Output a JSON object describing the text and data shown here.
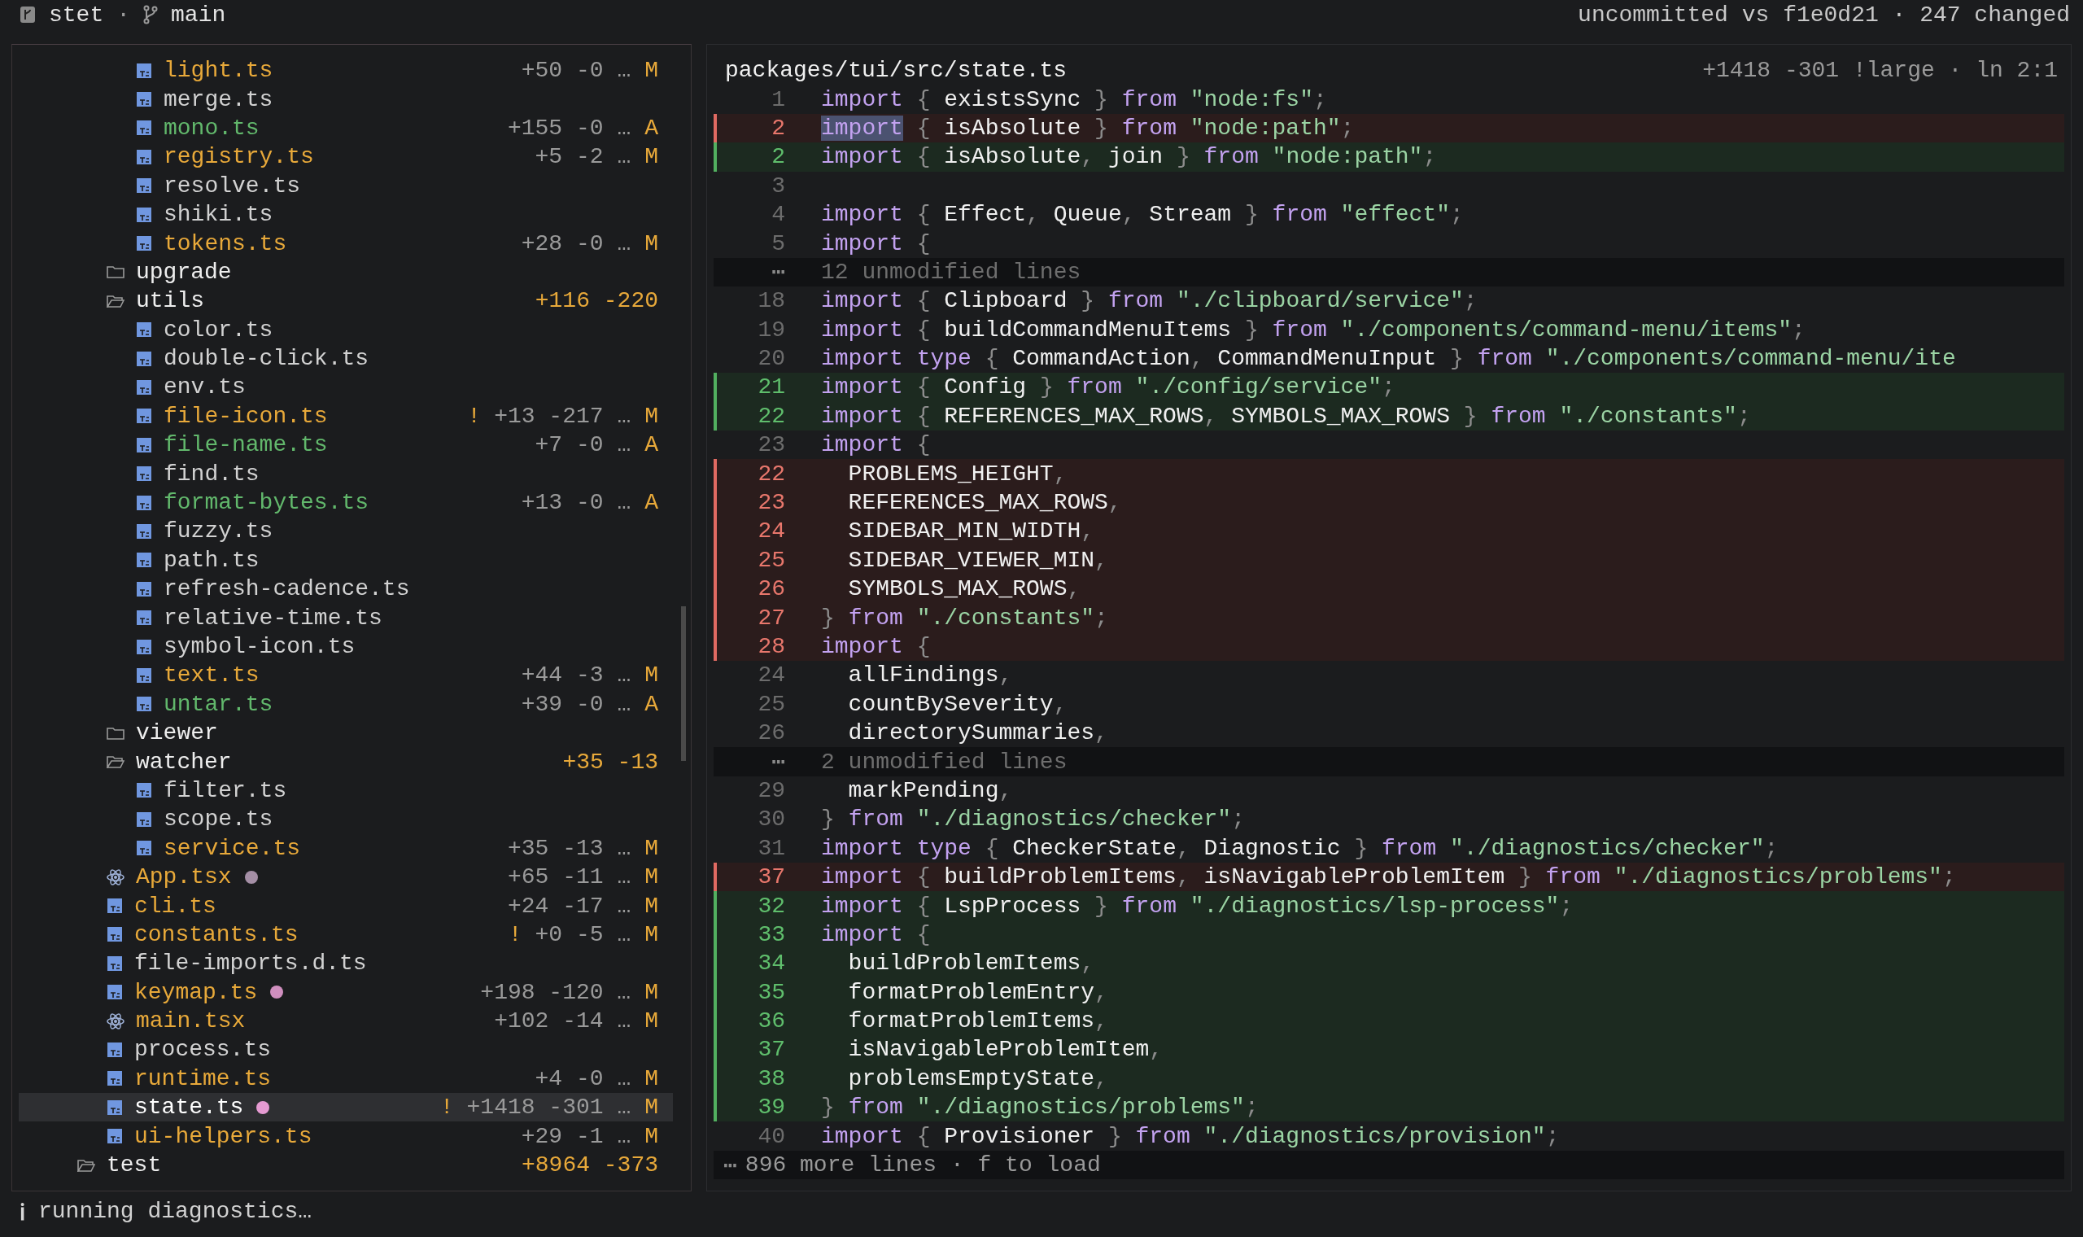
{
  "top_bar": {
    "repo": "stet",
    "separator": "·",
    "branch": "main",
    "summary": "uncommitted vs f1e0d21 · 247 changed"
  },
  "tree": [
    {
      "kind": "group",
      "children": [
        {
          "kind": "group",
          "children": [
            {
              "kind": "ts",
              "name": "light.ts",
              "stats": "+50 -0 …",
              "status": "M",
              "selected": false
            },
            {
              "kind": "ts",
              "name": "merge.ts",
              "selected": false
            },
            {
              "kind": "ts",
              "name": "mono.ts",
              "stats": "+155 -0 …",
              "status": "A",
              "selected": false
            },
            {
              "kind": "ts",
              "name": "registry.ts",
              "stats": "+5 -2 …",
              "status": "M",
              "selected": false
            },
            {
              "kind": "ts",
              "name": "resolve.ts",
              "selected": false
            },
            {
              "kind": "ts",
              "name": "shiki.ts",
              "selected": false
            },
            {
              "kind": "ts",
              "name": "tokens.ts",
              "stats": "+28 -0 …",
              "status": "M",
              "selected": false
            }
          ]
        },
        {
          "kind": "folder",
          "name": "upgrade",
          "expanded": false,
          "selected": false
        },
        {
          "kind": "folder",
          "name": "utils",
          "expanded": true,
          "stats": "+116 -220",
          "selected": false,
          "children": [
            {
              "kind": "ts",
              "name": "color.ts",
              "selected": false
            },
            {
              "kind": "ts",
              "name": "double-click.ts",
              "selected": false
            },
            {
              "kind": "ts",
              "name": "env.ts",
              "selected": false
            },
            {
              "kind": "ts",
              "name": "file-icon.ts",
              "warning": "!",
              "stats": "+13 -217 …",
              "status": "M",
              "selected": false
            },
            {
              "kind": "ts",
              "name": "file-name.ts",
              "stats": "+7 -0 …",
              "status": "A",
              "selected": false
            },
            {
              "kind": "ts",
              "name": "find.ts",
              "selected": false
            },
            {
              "kind": "ts",
              "name": "format-bytes.ts",
              "stats": "+13 -0 …",
              "status": "A",
              "selected": false
            },
            {
              "kind": "ts",
              "name": "fuzzy.ts",
              "selected": false
            },
            {
              "kind": "ts",
              "name": "path.ts",
              "selected": false
            },
            {
              "kind": "ts",
              "name": "refresh-cadence.ts",
              "selected": false
            },
            {
              "kind": "ts",
              "name": "relative-time.ts",
              "selected": false
            },
            {
              "kind": "ts",
              "name": "symbol-icon.ts",
              "selected": false
            },
            {
              "kind": "ts",
              "name": "text.ts",
              "stats": "+44 -3 …",
              "status": "M",
              "selected": false
            },
            {
              "kind": "ts",
              "name": "untar.ts",
              "stats": "+39 -0 …",
              "status": "A",
              "selected": false
            }
          ]
        },
        {
          "kind": "folder",
          "name": "viewer",
          "expanded": false,
          "selected": false
        },
        {
          "kind": "folder",
          "name": "watcher",
          "expanded": true,
          "stats": "+35 -13",
          "selected": false,
          "children": [
            {
              "kind": "ts",
              "name": "filter.ts",
              "selected": false
            },
            {
              "kind": "ts",
              "name": "scope.ts",
              "selected": false
            },
            {
              "kind": "ts",
              "name": "service.ts",
              "stats": "+35 -13 …",
              "status": "M",
              "selected": false
            }
          ]
        },
        {
          "kind": "tsx",
          "name": "App.tsx",
          "color": "#a58fa6",
          "stats": "+65 -11 …",
          "status": "M",
          "selected": false
        },
        {
          "kind": "ts",
          "name": "cli.ts",
          "stats": "+24 -17 …",
          "status": "M",
          "selected": false
        },
        {
          "kind": "ts",
          "name": "constants.ts",
          "warning": "!",
          "stats": "+0 -5 …",
          "status": "M",
          "selected": false
        },
        {
          "kind": "ts",
          "name": "file-imports.d.ts",
          "selected": false
        },
        {
          "kind": "ts",
          "name": "keymap.ts",
          "color": "#d08fbf",
          "stats": "+198 -120 …",
          "status": "M",
          "selected": false
        },
        {
          "kind": "tsx",
          "name": "main.tsx",
          "stats": "+102 -14 …",
          "status": "M",
          "selected": false
        },
        {
          "kind": "ts",
          "name": "process.ts",
          "selected": false
        },
        {
          "kind": "ts",
          "name": "runtime.ts",
          "stats": "+4 -0 …",
          "status": "M",
          "selected": false
        },
        {
          "kind": "ts",
          "name": "state.ts",
          "color": "#e59bd2",
          "warning": "!",
          "stats": "+1418 -301 …",
          "status": "M",
          "selected": true
        },
        {
          "kind": "ts",
          "name": "ui-helpers.ts",
          "stats": "+29 -1 …",
          "status": "M",
          "selected": false
        }
      ]
    },
    {
      "kind": "folder",
      "name": "test",
      "expanded": true,
      "stats": "+8964 -373",
      "selected": false
    }
  ],
  "diff": {
    "path": "packages/tui/src/state.ts",
    "info": "+1418 -301 !large · ln 2:1",
    "lines": [
      {
        "kind": "context",
        "num": "1",
        "code": "import { existsSync } from \"node:fs\";"
      },
      {
        "kind": "removed",
        "num": "2",
        "code": "import { isAbsolute } from \"node:path\";",
        "cursor": true
      },
      {
        "kind": "added",
        "num": "2",
        "code": "import { isAbsolute, join } from \"node:path\";"
      },
      {
        "kind": "context",
        "num": "3"
      },
      {
        "kind": "context",
        "num": "4",
        "code": "import { Effect, Queue, Stream } from \"effect\";"
      },
      {
        "kind": "context",
        "num": "5",
        "code": "import {"
      },
      {
        "kind": "fold",
        "marker": "⋯",
        "text": "12 unmodified lines"
      },
      {
        "kind": "context",
        "num": "18",
        "code": "import { Clipboard } from \"./clipboard/service\";"
      },
      {
        "kind": "context",
        "num": "19",
        "code": "import { buildCommandMenuItems } from \"./components/command-menu/items\";"
      },
      {
        "kind": "context",
        "num": "20",
        "code": "import type { CommandAction, CommandMenuInput } from \"./components/command-menu/ite"
      },
      {
        "kind": "added",
        "num": "21",
        "code": "import { Config } from \"./config/service\";"
      },
      {
        "kind": "added",
        "num": "22",
        "code": "import { REFERENCES_MAX_ROWS, SYMBOLS_MAX_ROWS } from \"./constants\";"
      },
      {
        "kind": "context",
        "num": "23",
        "code": "import {"
      },
      {
        "kind": "removed",
        "num": "22",
        "code": "  PROBLEMS_HEIGHT,"
      },
      {
        "kind": "removed",
        "num": "23",
        "code": "  REFERENCES_MAX_ROWS,"
      },
      {
        "kind": "removed",
        "num": "24",
        "code": "  SIDEBAR_MIN_WIDTH,"
      },
      {
        "kind": "removed",
        "num": "25",
        "code": "  SIDEBAR_VIEWER_MIN,"
      },
      {
        "kind": "removed",
        "num": "26",
        "code": "  SYMBOLS_MAX_ROWS,"
      },
      {
        "kind": "removed",
        "num": "27",
        "code": "} from \"./constants\";"
      },
      {
        "kind": "removed",
        "num": "28",
        "code": "import {"
      },
      {
        "kind": "context",
        "num": "24",
        "code": "  allFindings,"
      },
      {
        "kind": "context",
        "num": "25",
        "code": "  countBySeverity,"
      },
      {
        "kind": "context",
        "num": "26",
        "code": "  directorySummaries,"
      },
      {
        "kind": "fold",
        "marker": "⋯",
        "text": "2 unmodified lines"
      },
      {
        "kind": "context",
        "num": "29",
        "code": "  markPending,"
      },
      {
        "kind": "context",
        "num": "30",
        "code": "} from \"./diagnostics/checker\";"
      },
      {
        "kind": "context",
        "num": "31",
        "code": "import type { CheckerState, Diagnostic } from \"./diagnostics/checker\";"
      },
      {
        "kind": "removed",
        "num": "37",
        "code": "import { buildProblemItems, isNavigableProblemItem } from \"./diagnostics/problems\";"
      },
      {
        "kind": "added",
        "num": "32",
        "code": "import { LspProcess } from \"./diagnostics/lsp-process\";"
      },
      {
        "kind": "added",
        "num": "33",
        "code": "import {"
      },
      {
        "kind": "added",
        "num": "34",
        "code": "  buildProblemItems,"
      },
      {
        "kind": "added",
        "num": "35",
        "code": "  formatProblemEntry,"
      },
      {
        "kind": "added",
        "num": "36",
        "code": "  formatProblemItems,"
      },
      {
        "kind": "added",
        "num": "37",
        "code": "  isNavigableProblemItem,"
      },
      {
        "kind": "added",
        "num": "38",
        "code": "  problemsEmptyState,"
      },
      {
        "kind": "added",
        "num": "39",
        "code": "} from \"./diagnostics/problems\";"
      },
      {
        "kind": "context",
        "num": "40",
        "code": "import { Provisioner } from \"./diagnostics/provision\";"
      },
      {
        "kind": "more",
        "marker": "⋯",
        "text": "896 more lines · f to load"
      }
    ]
  },
  "status_bar": {
    "icon": "ℹ",
    "text": "running diagnostics…"
  }
}
